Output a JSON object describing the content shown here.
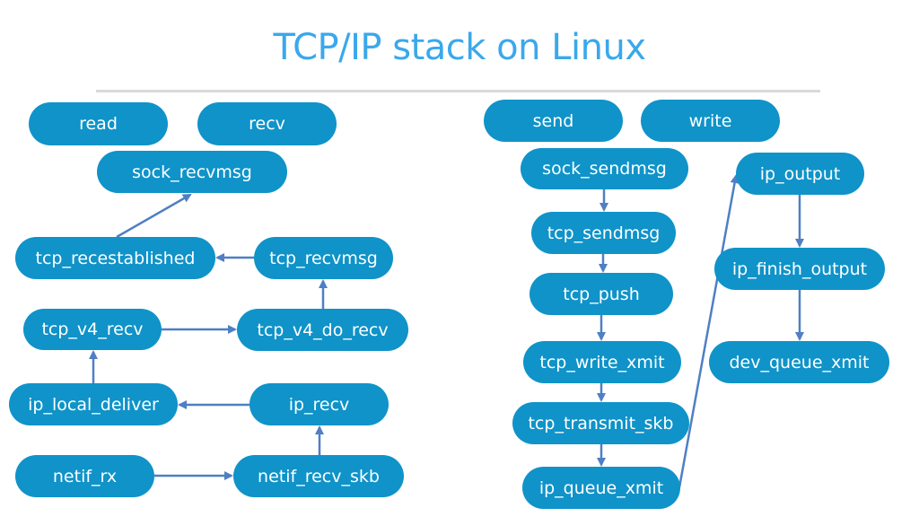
{
  "title": "TCP/IP stack on Linux",
  "colors": {
    "title": "#3aa8ec",
    "node_fill": "#0f93c9",
    "node_text": "#ffffff",
    "arrow": "#4f7fc4",
    "rule": "#d9d9d9"
  },
  "nodes": {
    "read": "read",
    "recv": "recv",
    "sock_recvmsg": "sock_recvmsg",
    "tcp_recestablished": "tcp_recestablished",
    "tcp_recvmsg": "tcp_recvmsg",
    "tcp_v4_recv": "tcp_v4_recv",
    "tcp_v4_do_recv": "tcp_v4_do_recv",
    "ip_local_deliver": "ip_local_deliver",
    "ip_recv": "ip_recv",
    "netif_rx": "netif_rx",
    "netif_recv_skb": "netif_recv_skb",
    "send": "send",
    "write": "write",
    "sock_sendmsg": "sock_sendmsg",
    "tcp_sendmsg": "tcp_sendmsg",
    "tcp_push": "tcp_push",
    "tcp_write_xmit": "tcp_write_xmit",
    "tcp_transmit_skb": "tcp_transmit_skb",
    "ip_queue_xmit": "ip_queue_xmit",
    "ip_output": "ip_output",
    "ip_finish_output": "ip_finish_output",
    "dev_queue_xmit": "dev_queue_xmit"
  },
  "edges": [
    {
      "from": "netif_rx",
      "to": "netif_recv_skb"
    },
    {
      "from": "netif_recv_skb",
      "to": "ip_recv"
    },
    {
      "from": "ip_recv",
      "to": "ip_local_deliver"
    },
    {
      "from": "ip_local_deliver",
      "to": "tcp_v4_recv"
    },
    {
      "from": "tcp_v4_recv",
      "to": "tcp_v4_do_recv"
    },
    {
      "from": "tcp_v4_do_recv",
      "to": "tcp_recvmsg"
    },
    {
      "from": "tcp_recvmsg",
      "to": "tcp_recestablished"
    },
    {
      "from": "tcp_recestablished",
      "to": "sock_recvmsg"
    },
    {
      "from": "sock_sendmsg",
      "to": "tcp_sendmsg"
    },
    {
      "from": "tcp_sendmsg",
      "to": "tcp_push"
    },
    {
      "from": "tcp_push",
      "to": "tcp_write_xmit"
    },
    {
      "from": "tcp_write_xmit",
      "to": "tcp_transmit_skb"
    },
    {
      "from": "tcp_transmit_skb",
      "to": "ip_queue_xmit"
    },
    {
      "from": "ip_queue_xmit",
      "to": "ip_output"
    },
    {
      "from": "ip_output",
      "to": "ip_finish_output"
    },
    {
      "from": "ip_finish_output",
      "to": "dev_queue_xmit"
    }
  ]
}
